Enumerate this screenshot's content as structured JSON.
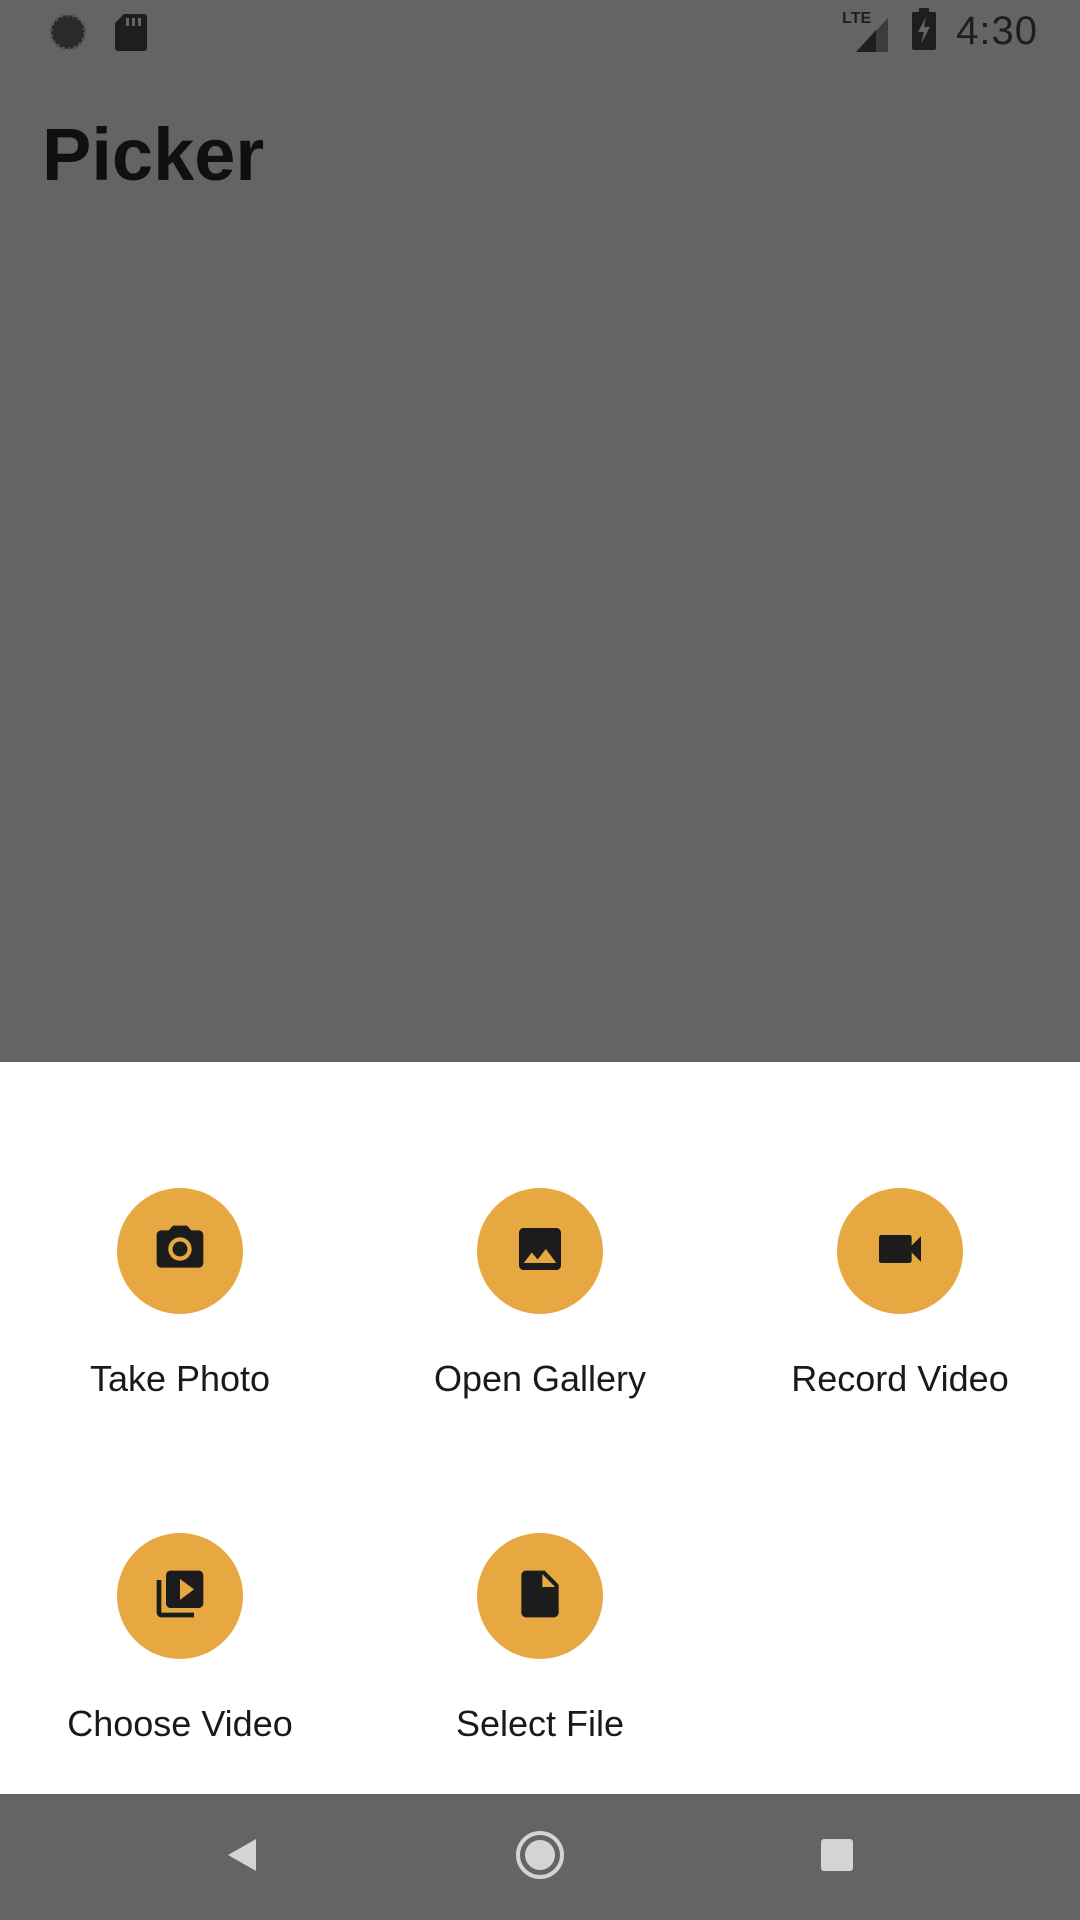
{
  "status_bar": {
    "time": "4:30",
    "network": "LTE",
    "icons": [
      "sync-icon",
      "sd-card-icon",
      "signal-icon",
      "battery-charging-icon"
    ]
  },
  "app": {
    "title": "Picker"
  },
  "sheet": {
    "options": [
      {
        "label": "Take Photo",
        "icon": "camera-icon"
      },
      {
        "label": "Open Gallery",
        "icon": "image-icon"
      },
      {
        "label": "Record Video",
        "icon": "videocam-icon"
      },
      {
        "label": "Choose Video",
        "icon": "video-library-icon"
      },
      {
        "label": "Select File",
        "icon": "file-icon"
      }
    ]
  },
  "nav_bar": {
    "icons": [
      "back-icon",
      "home-icon",
      "recents-icon"
    ]
  },
  "colors": {
    "scrim": "#646464",
    "accent": "#e7a842",
    "sheet_background": "#ffffff"
  }
}
